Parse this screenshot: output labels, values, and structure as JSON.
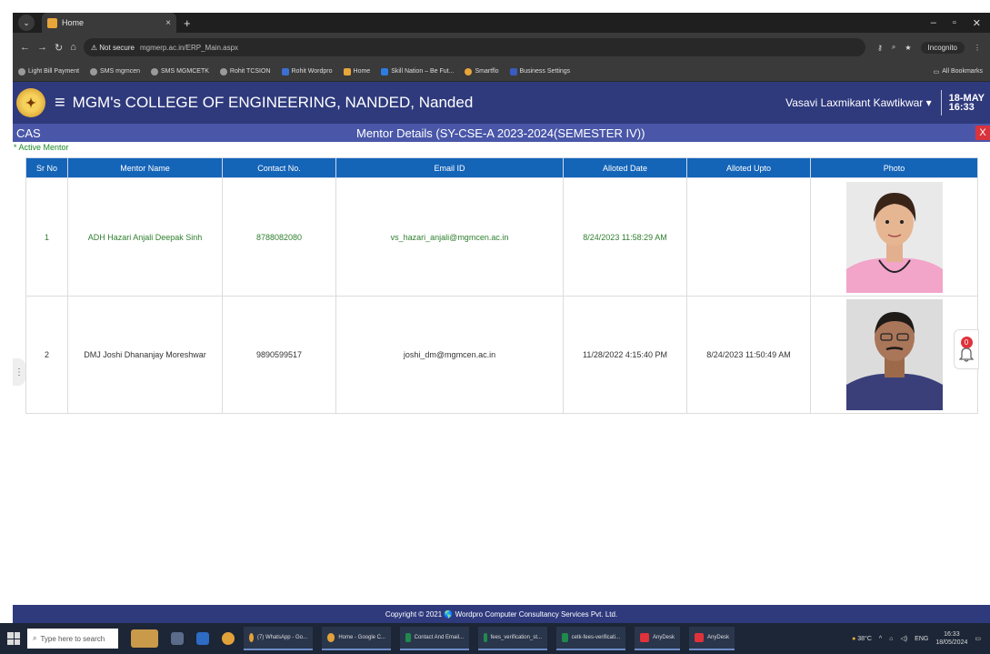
{
  "browser": {
    "tab_title": "Home",
    "url_security": "Not secure",
    "url": "mgmerp.ac.in/ERP_Main.aspx",
    "incognito_label": "Incognito",
    "bookmarks": [
      "Light Bill Payment",
      "SMS mgmcen",
      "SMS MGMCETK",
      "Rohit TCSION",
      "Rohit Wordpro",
      "Home",
      "Skill Nation – Be Fut...",
      "Smartflo",
      "Business Settings"
    ],
    "all_bookmarks_label": "All Bookmarks"
  },
  "header": {
    "college_name": "MGM's COLLEGE OF ENGINEERING, NANDED, Nanded",
    "user_name": "Vasavi Laxmikant Kawtikwar ▾",
    "date_day": "18-MAY",
    "date_time": "16:33"
  },
  "subheader": {
    "module": "CAS",
    "title": "Mentor Details  (SY-CSE-A  2023-2024(SEMESTER IV))",
    "close_label": "X"
  },
  "legend_active": "* Active Mentor",
  "table": {
    "headers": [
      "Sr No",
      "Mentor Name",
      "Contact No.",
      "Email ID",
      "Alloted Date",
      "Alloted Upto",
      "Photo"
    ],
    "rows": [
      {
        "sr": "1",
        "name": "ADH Hazari Anjali Deepak Sinh",
        "contact": "8788082080",
        "email": "vs_hazari_anjali@mgmcen.ac.in",
        "alloted_date": "8/24/2023 11:58:29 AM",
        "alloted_upto": "",
        "active": true
      },
      {
        "sr": "2",
        "name": "DMJ Joshi Dhananjay Moreshwar",
        "contact": "9890599517",
        "email": "joshi_dm@mgmcen.ac.in",
        "alloted_date": "11/28/2022 4:15:40 PM",
        "alloted_upto": "8/24/2023 11:50:49 AM",
        "active": false
      }
    ]
  },
  "notification_count": "0",
  "footer": {
    "copyright": "Copyright © 2021 🌎 Wordpro Computer Consultancy Services Pvt. Ltd."
  },
  "taskbar": {
    "search_placeholder": "Type here to search",
    "items": [
      "(7) WhatsApp - Go...",
      "Home - Google C...",
      "Contact And Email...",
      "fees_verification_st...",
      "cetk-fees-verificati...",
      "AnyDesk",
      "AnyDesk"
    ],
    "weather": "38°C",
    "lang": "ENG",
    "time": "16:33",
    "date": "18/05/2024"
  }
}
